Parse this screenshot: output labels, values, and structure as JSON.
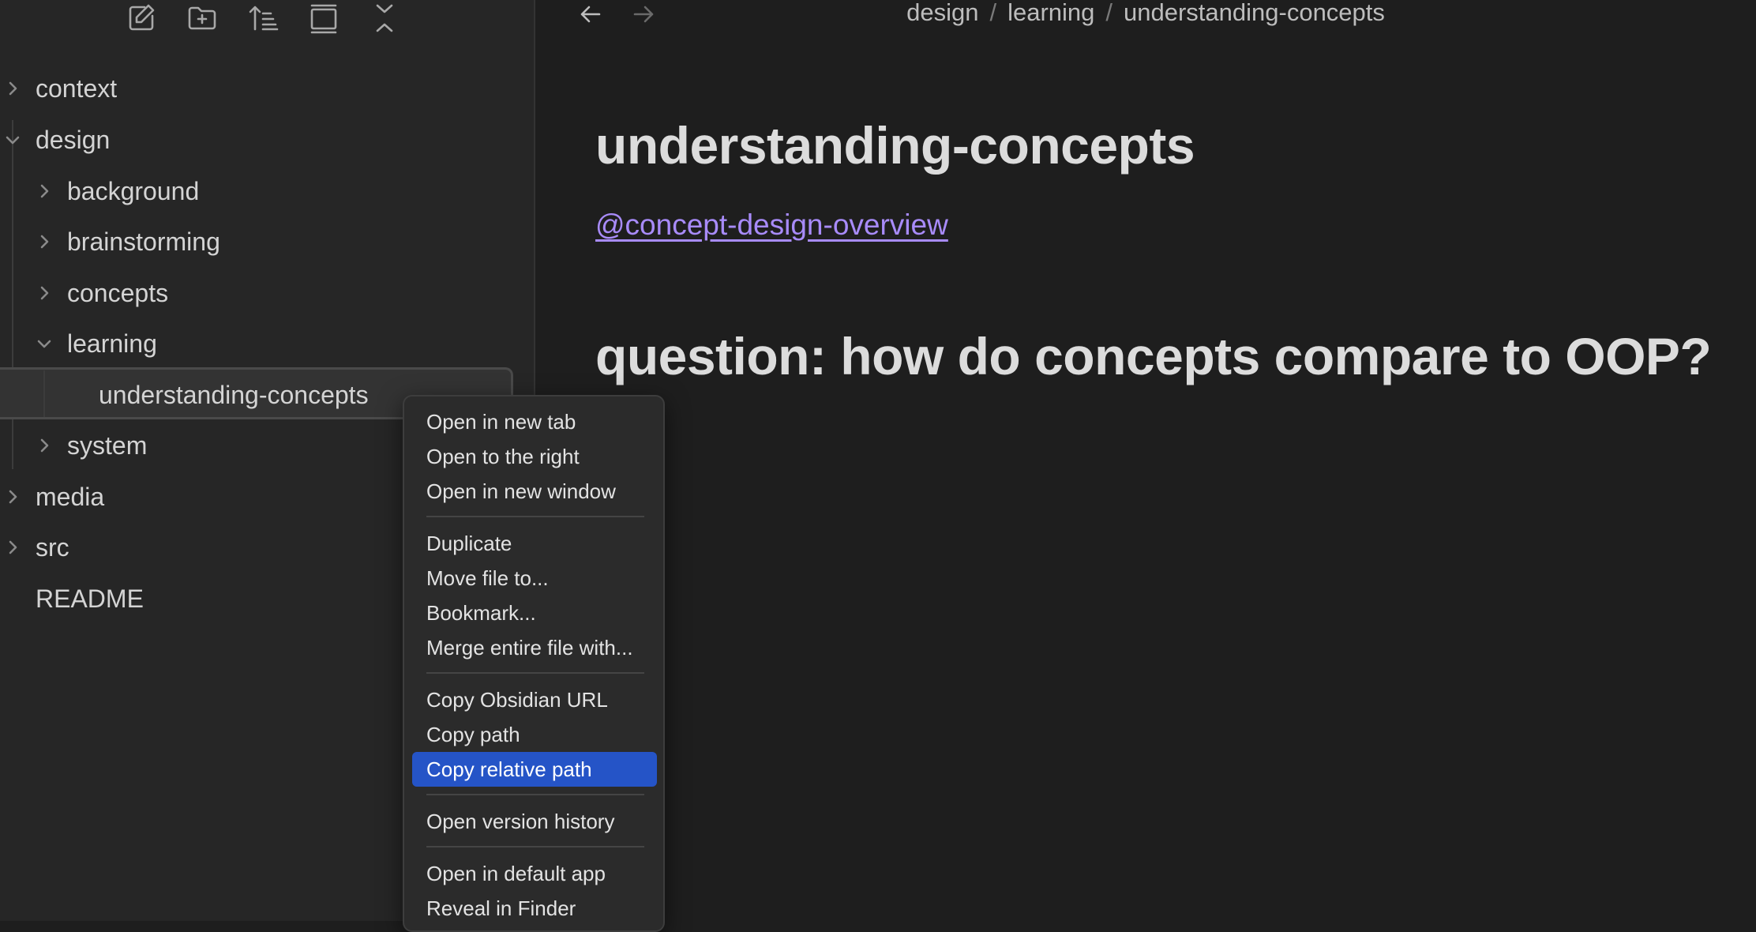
{
  "sidebar": {
    "toolbar": [
      {
        "name": "new-note-icon",
        "label": "New note"
      },
      {
        "name": "new-folder-icon",
        "label": "New folder"
      },
      {
        "name": "sort-icon",
        "label": "Change sort order"
      },
      {
        "name": "collapse-toggle-icon",
        "label": "Auto-reveal current file"
      },
      {
        "name": "collapse-all-icon",
        "label": "Collapse all"
      }
    ],
    "tree": {
      "context": "context",
      "design": "design",
      "background": "background",
      "brainstorming": "brainstorming",
      "concepts": "concepts",
      "learning": "learning",
      "understanding_concepts": "understanding-concepts",
      "system": "system",
      "media": "media",
      "src": "src",
      "readme": "README"
    }
  },
  "main": {
    "breadcrumb": [
      "design",
      "learning",
      "understanding-concepts"
    ],
    "breadcrumb_separator": "/",
    "title": "understanding-concepts",
    "link": "@concept-design-overview",
    "heading": "question: how do concepts compare to OOP?",
    "link_color": "#a88bfa"
  },
  "context_menu": {
    "items": [
      "Open in new tab",
      "Open to the right",
      "Open in new window",
      "Duplicate",
      "Move file to...",
      "Bookmark...",
      "Merge entire file with...",
      "Copy Obsidian URL",
      "Copy path",
      "Copy relative path",
      "Open version history",
      "Open in default app",
      "Reveal in Finder"
    ],
    "highlighted": "Copy relative path",
    "highlight_color": "#2554c7"
  }
}
